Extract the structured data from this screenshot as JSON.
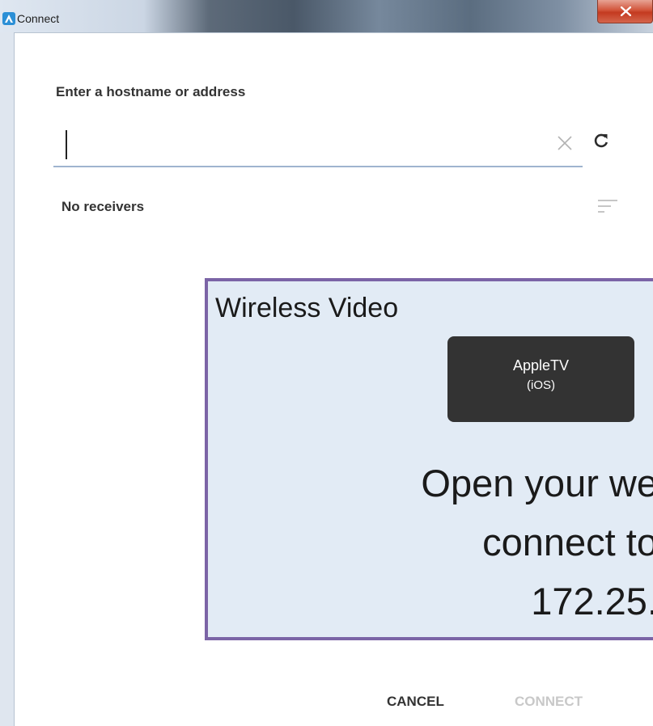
{
  "window": {
    "title": "Connect",
    "close_label": "Close",
    "icon": "app-logo-icon"
  },
  "host": {
    "label": "Enter a hostname or address",
    "value": "",
    "clear_icon": "clear-icon",
    "refresh_icon": "refresh-icon"
  },
  "receivers": {
    "status": "No receivers",
    "sort_icon": "sort-icon"
  },
  "overlay": {
    "title": "Wireless Video",
    "apple_tv_label": "AppleTV",
    "apple_tv_sub": "(iOS)",
    "line1": "Open your we",
    "line2": "connect to",
    "line3": "172.25."
  },
  "actions": {
    "cancel": "CANCEL",
    "connect": "CONNECT"
  },
  "colors": {
    "overlay_border": "#7b64a6",
    "overlay_bg": "#e2ebf5",
    "input_underline": "#9fb4cf",
    "disabled_text": "#c8c8c8"
  }
}
